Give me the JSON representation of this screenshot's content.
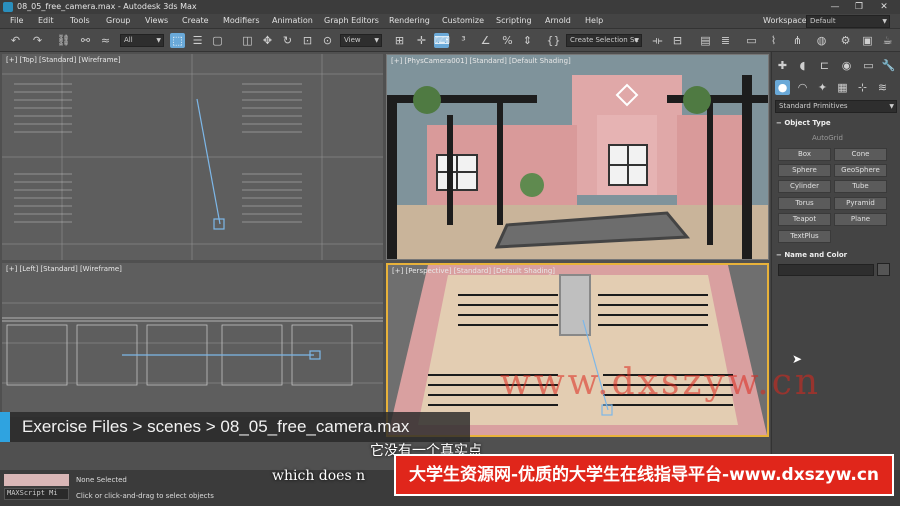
{
  "window": {
    "title": "08_05_free_camera.max - Autodesk 3ds Max",
    "controls": [
      "—",
      "❐",
      "✕"
    ]
  },
  "menu": {
    "items": [
      "File",
      "Edit",
      "Tools",
      "Group",
      "Views",
      "Create",
      "Modifiers",
      "Animation",
      "Graph Editors",
      "Rendering",
      "Customize",
      "Scripting",
      "Arnold",
      "Help"
    ]
  },
  "workspace": {
    "label": "Workspaces:",
    "value": "Default"
  },
  "toolbar": {
    "filter_value": "All",
    "refcoord_value": "View",
    "selection_set_placeholder": "Create Selection Se"
  },
  "viewports": {
    "top": "[+] [Top] [Standard] [Wireframe]",
    "camera": "[+] [PhysCamera001] [Standard] [Default Shading]",
    "left": "[+] [Left] [Standard] [Wireframe]",
    "perspective": "[+] [Perspective] [Standard] [Default Shading]"
  },
  "command_panel": {
    "category_dropdown": "Standard Primitives",
    "object_type_title": "Object Type",
    "autogrid": "AutoGrid",
    "buttons": [
      "Box",
      "Cone",
      "Sphere",
      "GeoSphere",
      "Cylinder",
      "Tube",
      "Torus",
      "Pyramid",
      "Teapot",
      "Plane",
      "TextPlus"
    ],
    "name_color_title": "Name and Color"
  },
  "status": {
    "maxscript": "MAXScript Mi",
    "selection": "None Selected",
    "prompt": "Click or click-and-drag to select objects"
  },
  "overlay": {
    "breadcrumb": "Exercise Files > scenes > 08_05_free_camera.max",
    "subtitle_en": "which does n",
    "subtitle_cn": "它没有一个真实点",
    "banner": "大学生资源网-优质的大学生在线指导平台-www.dxszyw.cn",
    "watermark": "www.dxszyw.cn"
  },
  "colors": {
    "accent": "#2fa3e0",
    "active_viewport": "#e8b23a",
    "banner_red": "#e0261b",
    "wall_pink": "#d99a9a"
  }
}
